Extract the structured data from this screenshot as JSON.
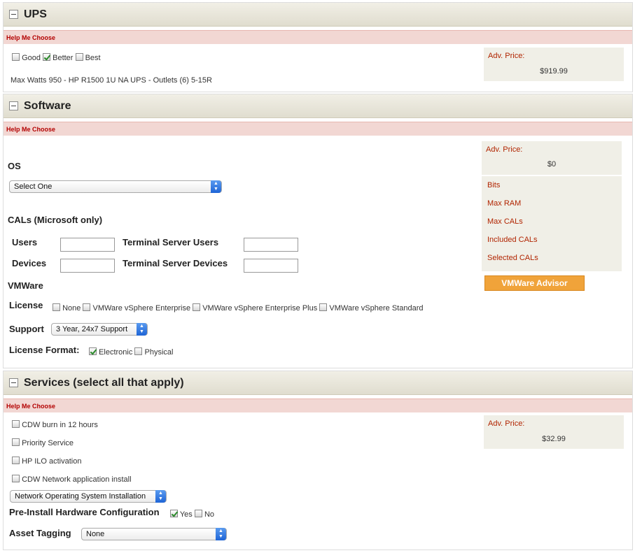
{
  "ups": {
    "title": "UPS",
    "help": "Help Me Choose",
    "options": [
      "Good",
      "Better",
      "Best"
    ],
    "description": "Max Watts 950 - HP R1500 1U NA UPS - Outlets (6) 5-15R",
    "price_label": "Adv. Price:",
    "price": "$919.99"
  },
  "software": {
    "title": "Software",
    "help": "Help Me Choose",
    "os_label": "OS",
    "os_select": "Select One",
    "cals_label": "CALs (Microsoft only)",
    "users_label": "Users",
    "devices_label": "Devices",
    "ts_users_label": "Terminal Server Users",
    "ts_devices_label": "Terminal Server Devices",
    "vmware_label": "VMWare",
    "license_label": "License",
    "license_options": [
      "None",
      "VMWare vSphere Enterprise",
      "VMWare vSphere Enterprise Plus",
      "VMWare vSphere Standard"
    ],
    "support_label": "Support",
    "support_select": "3 Year, 24x7 Support",
    "format_label": "License Format:",
    "format_options": [
      "Electronic",
      "Physical"
    ],
    "price_label": "Adv. Price:",
    "price": "$0",
    "specs": [
      "Bits",
      "Max RAM",
      "Max CALs",
      "Included CALs",
      "Selected CALs"
    ],
    "vm_advisor": "VMWare Advisor"
  },
  "services": {
    "title": "Services (select all that apply)",
    "help": "Help Me Choose",
    "items": [
      "CDW burn in 12 hours",
      "Priority Service",
      "HP ILO activation",
      "CDW Network application install"
    ],
    "nos_select": "Network Operating System Installation",
    "preinstall_label": "Pre-Install Hardware Configuration",
    "preinstall_options": [
      "Yes",
      "No"
    ],
    "asset_label": "Asset Tagging",
    "asset_select": "None",
    "price_label": "Adv. Price:",
    "price": "$32.99"
  },
  "colors": {
    "accent_red": "#b12400",
    "help_bg": "#f2d7d3",
    "button_orange": "#f0a33a"
  }
}
